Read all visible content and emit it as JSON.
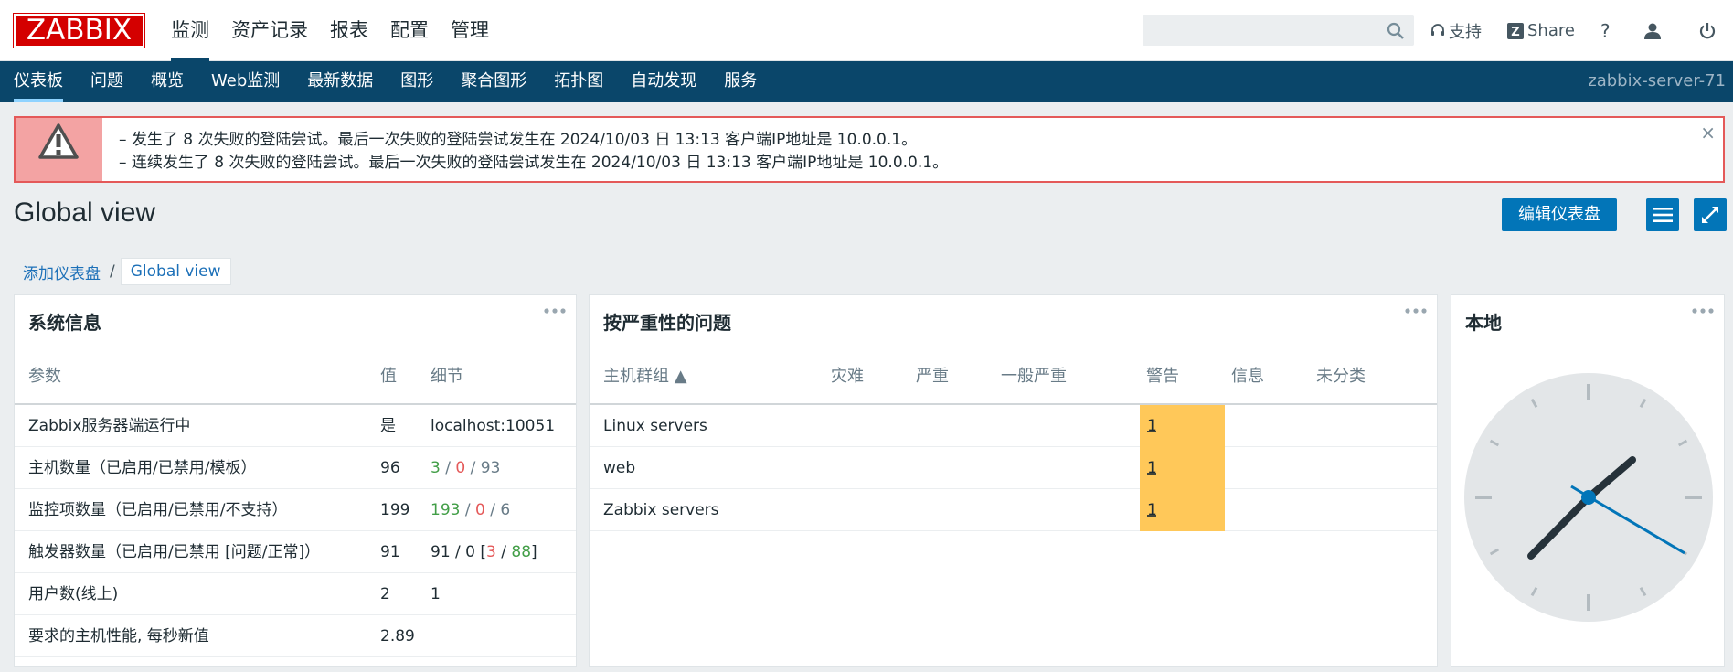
{
  "header": {
    "logo": "ZABBIX",
    "menu": [
      "监测",
      "资产记录",
      "报表",
      "配置",
      "管理"
    ],
    "search_placeholder": "",
    "support_label": "支持",
    "share_label": "Share",
    "help_label": "?"
  },
  "subnav": {
    "items": [
      "仪表板",
      "问题",
      "概览",
      "Web监测",
      "最新数据",
      "图形",
      "聚合图形",
      "拓扑图",
      "自动发现",
      "服务"
    ],
    "server_name": "zabbix-server-71"
  },
  "alert": {
    "messages": [
      "– 发生了 8 次失败的登陆尝试。最后一次失败的登陆尝试发生在 2024/10/03 日 13:13 客户端IP地址是 10.0.0.1。",
      "– 连续发生了 8 次失败的登陆尝试。最后一次失败的登陆尝试发生在 2024/10/03 日 13:13 客户端IP地址是 10.0.0.1。"
    ],
    "close": "×",
    "color": "#e45959"
  },
  "page": {
    "title": "Global view",
    "edit_button": "编辑仪表盘"
  },
  "breadcrumb": {
    "parent": "添加仪表盘",
    "separator": "/",
    "current": "Global view"
  },
  "system_info": {
    "title": "系统信息",
    "headers": {
      "param": "参数",
      "value": "值",
      "details": "细节"
    },
    "rows": [
      {
        "param": "Zabbix服务器端运行中",
        "value": "是",
        "details": "localhost:10051"
      },
      {
        "param": "主机数量（已启用/已禁用/模板）",
        "value": "96",
        "d1": "3",
        "s1": " / ",
        "d2": "0",
        "s2": " / ",
        "d3": "93"
      },
      {
        "param": "监控项数量（已启用/已禁用/不支持）",
        "value": "199",
        "d1": "193",
        "s1": " / ",
        "d2": "0",
        "s2": " / ",
        "d3": "6"
      },
      {
        "param": "触发器数量（已启用/已禁用 [问题/正常]）",
        "value": "91",
        "d0": "91 / 0 [",
        "d1": "3",
        "s1": " / ",
        "d2": "88",
        "d3": "]"
      },
      {
        "param": "用户数(线上)",
        "value": "2",
        "details": "1"
      },
      {
        "param": "要求的主机性能, 每秒新值",
        "value": "2.89",
        "details": ""
      }
    ]
  },
  "problems_by_severity": {
    "title": "按严重性的问题",
    "headers": {
      "group": "主机群组 ▲",
      "disaster": "灾难",
      "high": "严重",
      "average": "一般严重",
      "warning": "警告",
      "info": "信息",
      "not_classified": "未分类"
    },
    "rows": [
      {
        "group": "Linux servers",
        "warning": "1"
      },
      {
        "group": "web",
        "warning": "1"
      },
      {
        "group": "Zabbix servers",
        "warning": "1"
      }
    ],
    "warning_color": "#ffc859"
  },
  "clock": {
    "title": "本地"
  }
}
